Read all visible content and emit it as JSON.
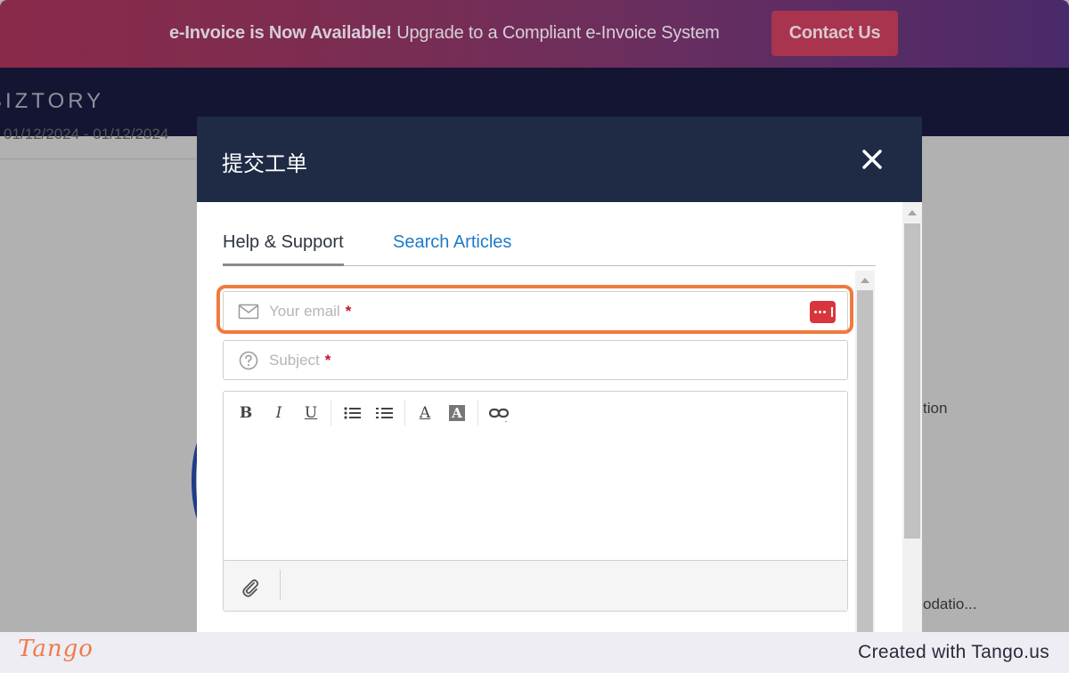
{
  "banner": {
    "headline": "e-Invoice is Now Available!",
    "subtext": "Upgrade to a Compliant e-Invoice System",
    "contact_button": "Contact Us"
  },
  "nav": {
    "logo_text": "BIZTORY"
  },
  "background": {
    "date_range": "01/12/2024 - 01/12/2024",
    "right_text_1": "tion",
    "right_text_2": "odatio..."
  },
  "modal": {
    "title": "提交工单",
    "tabs": [
      {
        "label": "Help & Support",
        "active": true
      },
      {
        "label": "Search Articles",
        "active": false
      }
    ],
    "email": {
      "placeholder": "Your email",
      "required_mark": "*",
      "icon": "envelope-icon"
    },
    "subject": {
      "placeholder": "Subject",
      "required_mark": "*",
      "icon": "question-circle-icon"
    },
    "editor_toolbar": [
      {
        "name": "bold",
        "glyph": "B"
      },
      {
        "name": "italic",
        "glyph": "I"
      },
      {
        "name": "underline",
        "glyph": "U"
      },
      {
        "name": "bulleted-list",
        "glyph": ""
      },
      {
        "name": "numbered-list",
        "glyph": ""
      },
      {
        "name": "font-color",
        "glyph": "A"
      },
      {
        "name": "background-color",
        "glyph": "A"
      },
      {
        "name": "link",
        "glyph": ""
      }
    ]
  },
  "footer": {
    "logo": "Tango",
    "credit": "Created with Tango.us"
  },
  "colors": {
    "banner_gradient_start": "#8a2a4a",
    "banner_gradient_end": "#4a2a6a",
    "contact_button": "#a8344e",
    "nav": "#141433",
    "modal_header": "#1f2a45",
    "tab_link": "#1f7bc8",
    "highlight": "#f07a3e",
    "required": "#c8102e",
    "tango_orange": "#f07a4e"
  }
}
